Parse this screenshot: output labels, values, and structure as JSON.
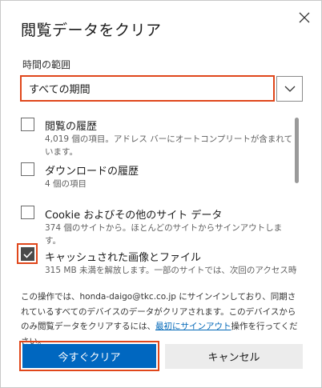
{
  "dialog": {
    "title": "閲覧データをクリア"
  },
  "time_range": {
    "label": "時間の範囲",
    "selected": "すべての期間"
  },
  "items": [
    {
      "title": "閲覧の履歴",
      "desc": "4,019 個の項目。アドレス バーにオートコンプリートが含まれています。",
      "checked": false
    },
    {
      "title": "ダウンロードの履歴",
      "desc": "4 個の項目",
      "checked": false
    },
    {
      "title": "Cookie およびその他のサイト データ",
      "desc": "374 個のサイトから。ほとんどのサイトからサインアウトします。",
      "checked": false
    },
    {
      "title": "キャッシュされた画像とファイル",
      "desc": "315 MB 未満を解放します。一部のサイトでは、次回のアクセス時",
      "checked": true
    }
  ],
  "notice": {
    "part1": "この操作では、honda-daigo@tkc.co.jp にサインインしており、同期されているすべてのデバイスのデータがクリアされます。このデバイスからのみ閲覧データをクリアするには、",
    "link": "最初にサインアウト",
    "part2": "操作を行ってください。"
  },
  "buttons": {
    "clear": "今すぐクリア",
    "cancel": "キャンセル"
  },
  "colors": {
    "accent": "#0067c0",
    "highlight": "#e0471b",
    "link": "#0067b8"
  },
  "icons": {
    "close": "close-icon",
    "dropdown": "chevron-down-icon",
    "check": "checkmark-icon"
  }
}
